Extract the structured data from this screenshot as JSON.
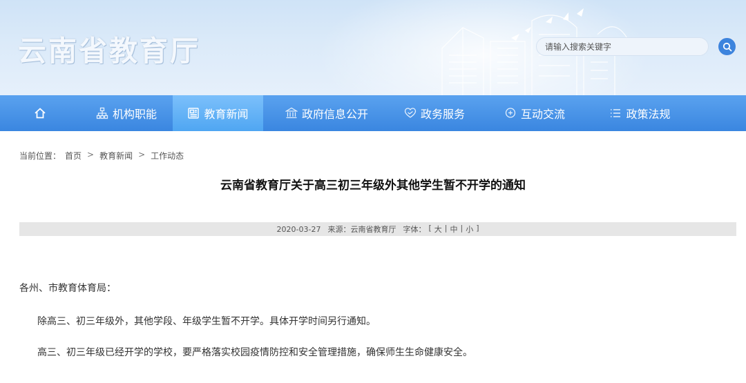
{
  "site": {
    "title": "云南省教育厅",
    "search_placeholder": "请输入搜索关键字",
    "accent_color": "#3a86e0"
  },
  "nav": {
    "items": [
      {
        "label": "",
        "icon": "home-icon"
      },
      {
        "label": "机构职能",
        "icon": "org-chart-icon"
      },
      {
        "label": "教育新闻",
        "icon": "newspaper-icon",
        "active": true
      },
      {
        "label": "政府信息公开",
        "icon": "government-building-icon"
      },
      {
        "label": "政务服务",
        "icon": "handshake-heart-icon"
      },
      {
        "label": "互动交流",
        "icon": "chat-bubble-icon"
      },
      {
        "label": "政策法规",
        "icon": "list-icon"
      }
    ]
  },
  "breadcrumb": {
    "label": "当前位置：",
    "items": [
      "首页",
      "教育新闻",
      "工作动态"
    ],
    "separator": ">"
  },
  "article": {
    "title": "云南省教育厅关于高三初三年级外其他学生暂不开学的通知",
    "date": "2020-03-27",
    "source": "来源：云南省教育厅",
    "font_size_label": "字体：",
    "font_sizes": [
      "大",
      "中",
      "小"
    ],
    "paragraphs": [
      "各州、市教育体育局：",
      "除高三、初三年级外，其他学段、年级学生暂不开学。具体开学时间另行通知。",
      "高三、初三年级已经开学的学校，要严格落实校园疫情防控和安全管理措施，确保师生生命健康安全。"
    ]
  }
}
